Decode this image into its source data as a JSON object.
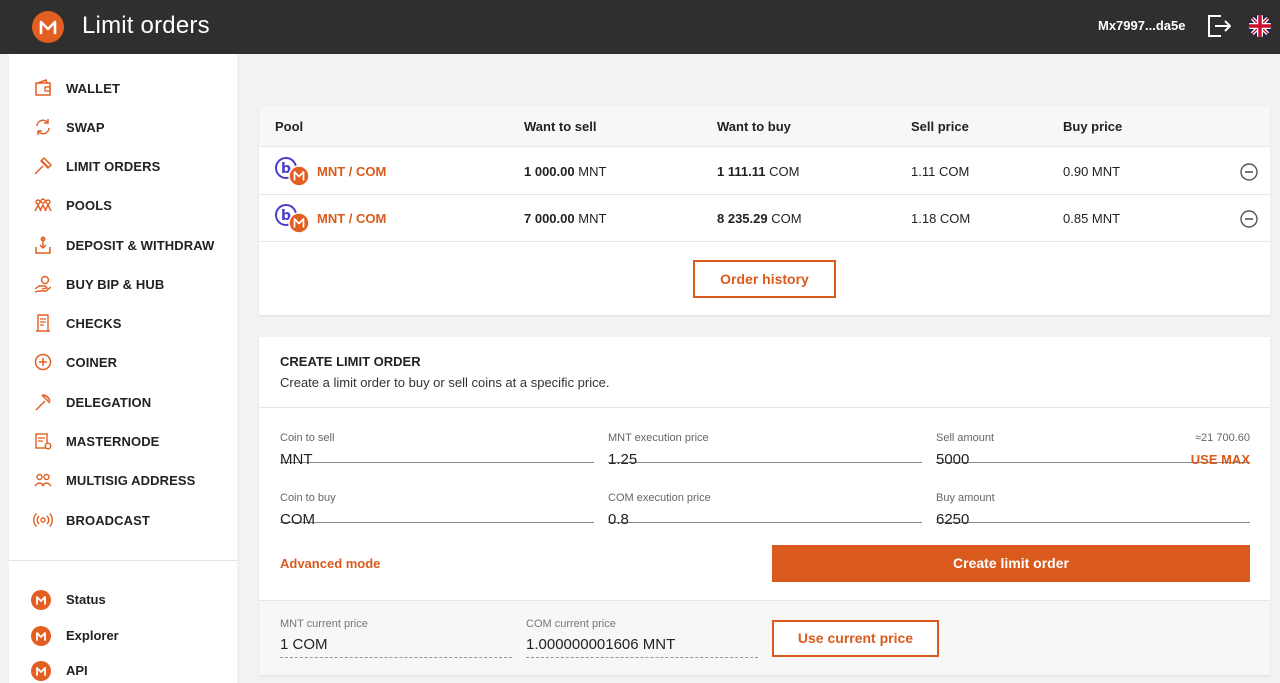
{
  "header": {
    "title": "Limit orders",
    "address": "Mx7997...da5e",
    "logo_icon": "minter-logo-icon",
    "logout_icon": "logout-icon",
    "language_icon": "uk-flag-icon"
  },
  "colors": {
    "accent": "#d95a1c",
    "header_bg": "#2f2f2f",
    "logo": "#e35f21"
  },
  "sidebar": {
    "items": [
      {
        "label": "WALLET",
        "icon": "wallet-icon"
      },
      {
        "label": "SWAP",
        "icon": "swap-icon"
      },
      {
        "label": "LIMIT ORDERS",
        "icon": "limit-orders-icon"
      },
      {
        "label": "POOLS",
        "icon": "pools-icon"
      },
      {
        "label": "DEPOSIT & WITHDRAW",
        "icon": "deposit-withdraw-icon"
      },
      {
        "label": "BUY BIP & HUB",
        "icon": "buy-icon"
      },
      {
        "label": "CHECKS",
        "icon": "checks-icon"
      },
      {
        "label": "COINER",
        "icon": "coiner-icon"
      },
      {
        "label": "DELEGATION",
        "icon": "delegation-icon"
      },
      {
        "label": "MASTERNODE",
        "icon": "masternode-icon"
      },
      {
        "label": "MULTISIG ADDRESS",
        "icon": "multisig-icon"
      },
      {
        "label": "BROADCAST",
        "icon": "broadcast-icon"
      }
    ],
    "links": [
      {
        "label": "Status"
      },
      {
        "label": "Explorer"
      },
      {
        "label": "API"
      }
    ]
  },
  "orders": {
    "columns": [
      "Pool",
      "Want to sell",
      "Want to buy",
      "Sell price",
      "Buy price"
    ],
    "rows": [
      {
        "pool": "MNT / COM",
        "sell_amount": "1 000.00",
        "sell_coin": "MNT",
        "buy_amount": "1 111.11",
        "buy_coin": "COM",
        "sell_price": "1.11 COM",
        "buy_price": "0.90 MNT"
      },
      {
        "pool": "MNT / COM",
        "sell_amount": "7 000.00",
        "sell_coin": "MNT",
        "buy_amount": "8 235.29",
        "buy_coin": "COM",
        "sell_price": "1.18 COM",
        "buy_price": "0.85 MNT"
      }
    ],
    "history_button": "Order history"
  },
  "create": {
    "title": "CREATE LIMIT ORDER",
    "subtitle": "Create a limit order to buy or sell coins at a specific price.",
    "coin_to_sell": {
      "label": "Coin to sell",
      "value": "MNT"
    },
    "sell_exec_price": {
      "label": "MNT execution price",
      "value": "1.25"
    },
    "sell_amount": {
      "label": "Sell amount",
      "value": "5000",
      "hint": "≈21 700.60",
      "use_max": "USE MAX"
    },
    "coin_to_buy": {
      "label": "Coin to buy",
      "value": "COM"
    },
    "buy_exec_price": {
      "label": "COM execution price",
      "value": "0.8"
    },
    "buy_amount": {
      "label": "Buy amount",
      "value": "6250"
    },
    "advanced_mode": "Advanced mode",
    "submit_button": "Create limit order",
    "mnt_current": {
      "label": "MNT current price",
      "value": "1 COM"
    },
    "com_current": {
      "label": "COM current price",
      "value": "1.000000001606 MNT"
    },
    "use_current_button": "Use current price"
  }
}
